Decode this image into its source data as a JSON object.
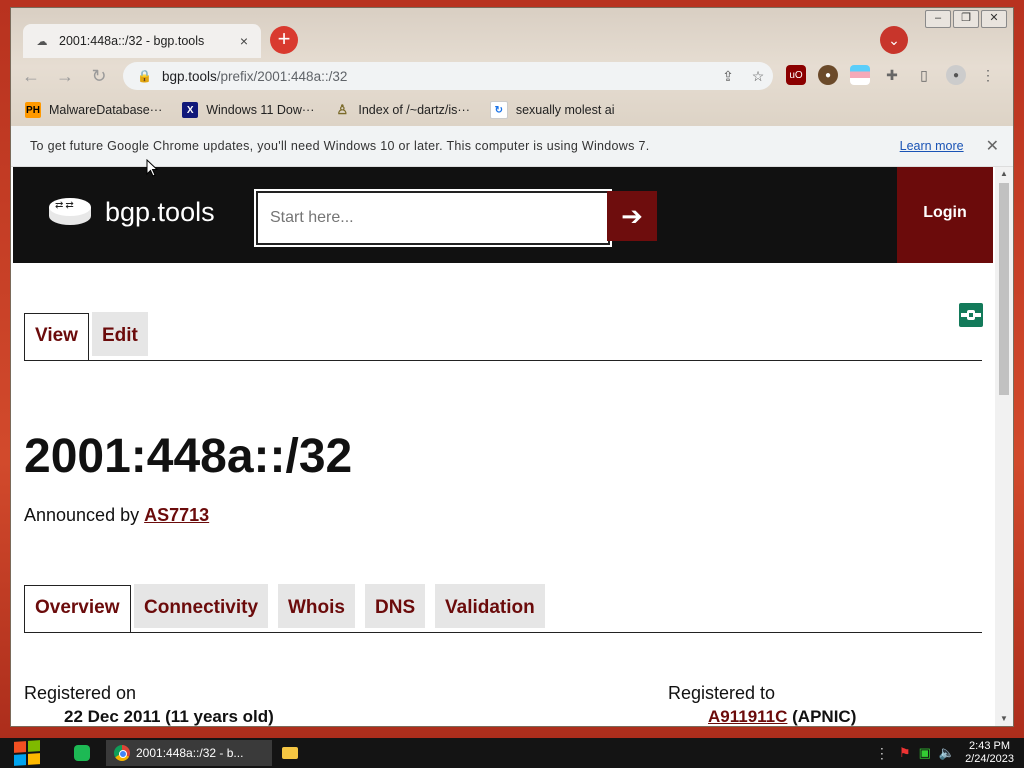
{
  "browser": {
    "tab_title": "2001:448a::/32 - bgp.tools",
    "tab_close": "×",
    "new_tab": "+",
    "url_host": "bgp.tools",
    "url_path": "/prefix/2001:448a::/32",
    "bookmarks": [
      {
        "label": "MalwareDatabase···",
        "icon": "PH"
      },
      {
        "label": "Windows 11 Dow···",
        "icon": "X"
      },
      {
        "label": "Index of /~dartz/is···",
        "icon": "person"
      },
      {
        "label": "sexually molest ai",
        "icon": "page"
      }
    ],
    "infobar": {
      "message": "To get future Google Chrome updates, you'll need Windows 10 or later. This computer is using Windows 7.",
      "link": "Learn more",
      "close": "✕"
    }
  },
  "site": {
    "logo_text": "bgp.tools",
    "search_placeholder": "Start here...",
    "search_button": "➔",
    "login": "Login"
  },
  "page": {
    "view_tabs": [
      {
        "label": "View",
        "active": true
      },
      {
        "label": "Edit",
        "active": false
      }
    ],
    "prefix": "2001:448a::/32",
    "announced_prefix": "Announced by",
    "announced_asn": "AS7713",
    "section_tabs": [
      {
        "label": "Overview",
        "active": true
      },
      {
        "label": "Connectivity",
        "active": false
      },
      {
        "label": "Whois",
        "active": false
      },
      {
        "label": "DNS",
        "active": false
      },
      {
        "label": "Validation",
        "active": false
      }
    ],
    "registered_on_label": "Registered on",
    "registered_on_value": "22 Dec 2011 (11 years old)",
    "registered_to_label": "Registered to",
    "registered_to_handle": "A911911C",
    "registered_to_rir": "(APNIC)"
  },
  "taskbar": {
    "chrome_item": "2001:448a::/32 - b...",
    "time": "2:43 PM",
    "date": "2/24/2023"
  },
  "colors": {
    "brand_dark_red": "#6b0b0b",
    "header_black": "#111111"
  }
}
